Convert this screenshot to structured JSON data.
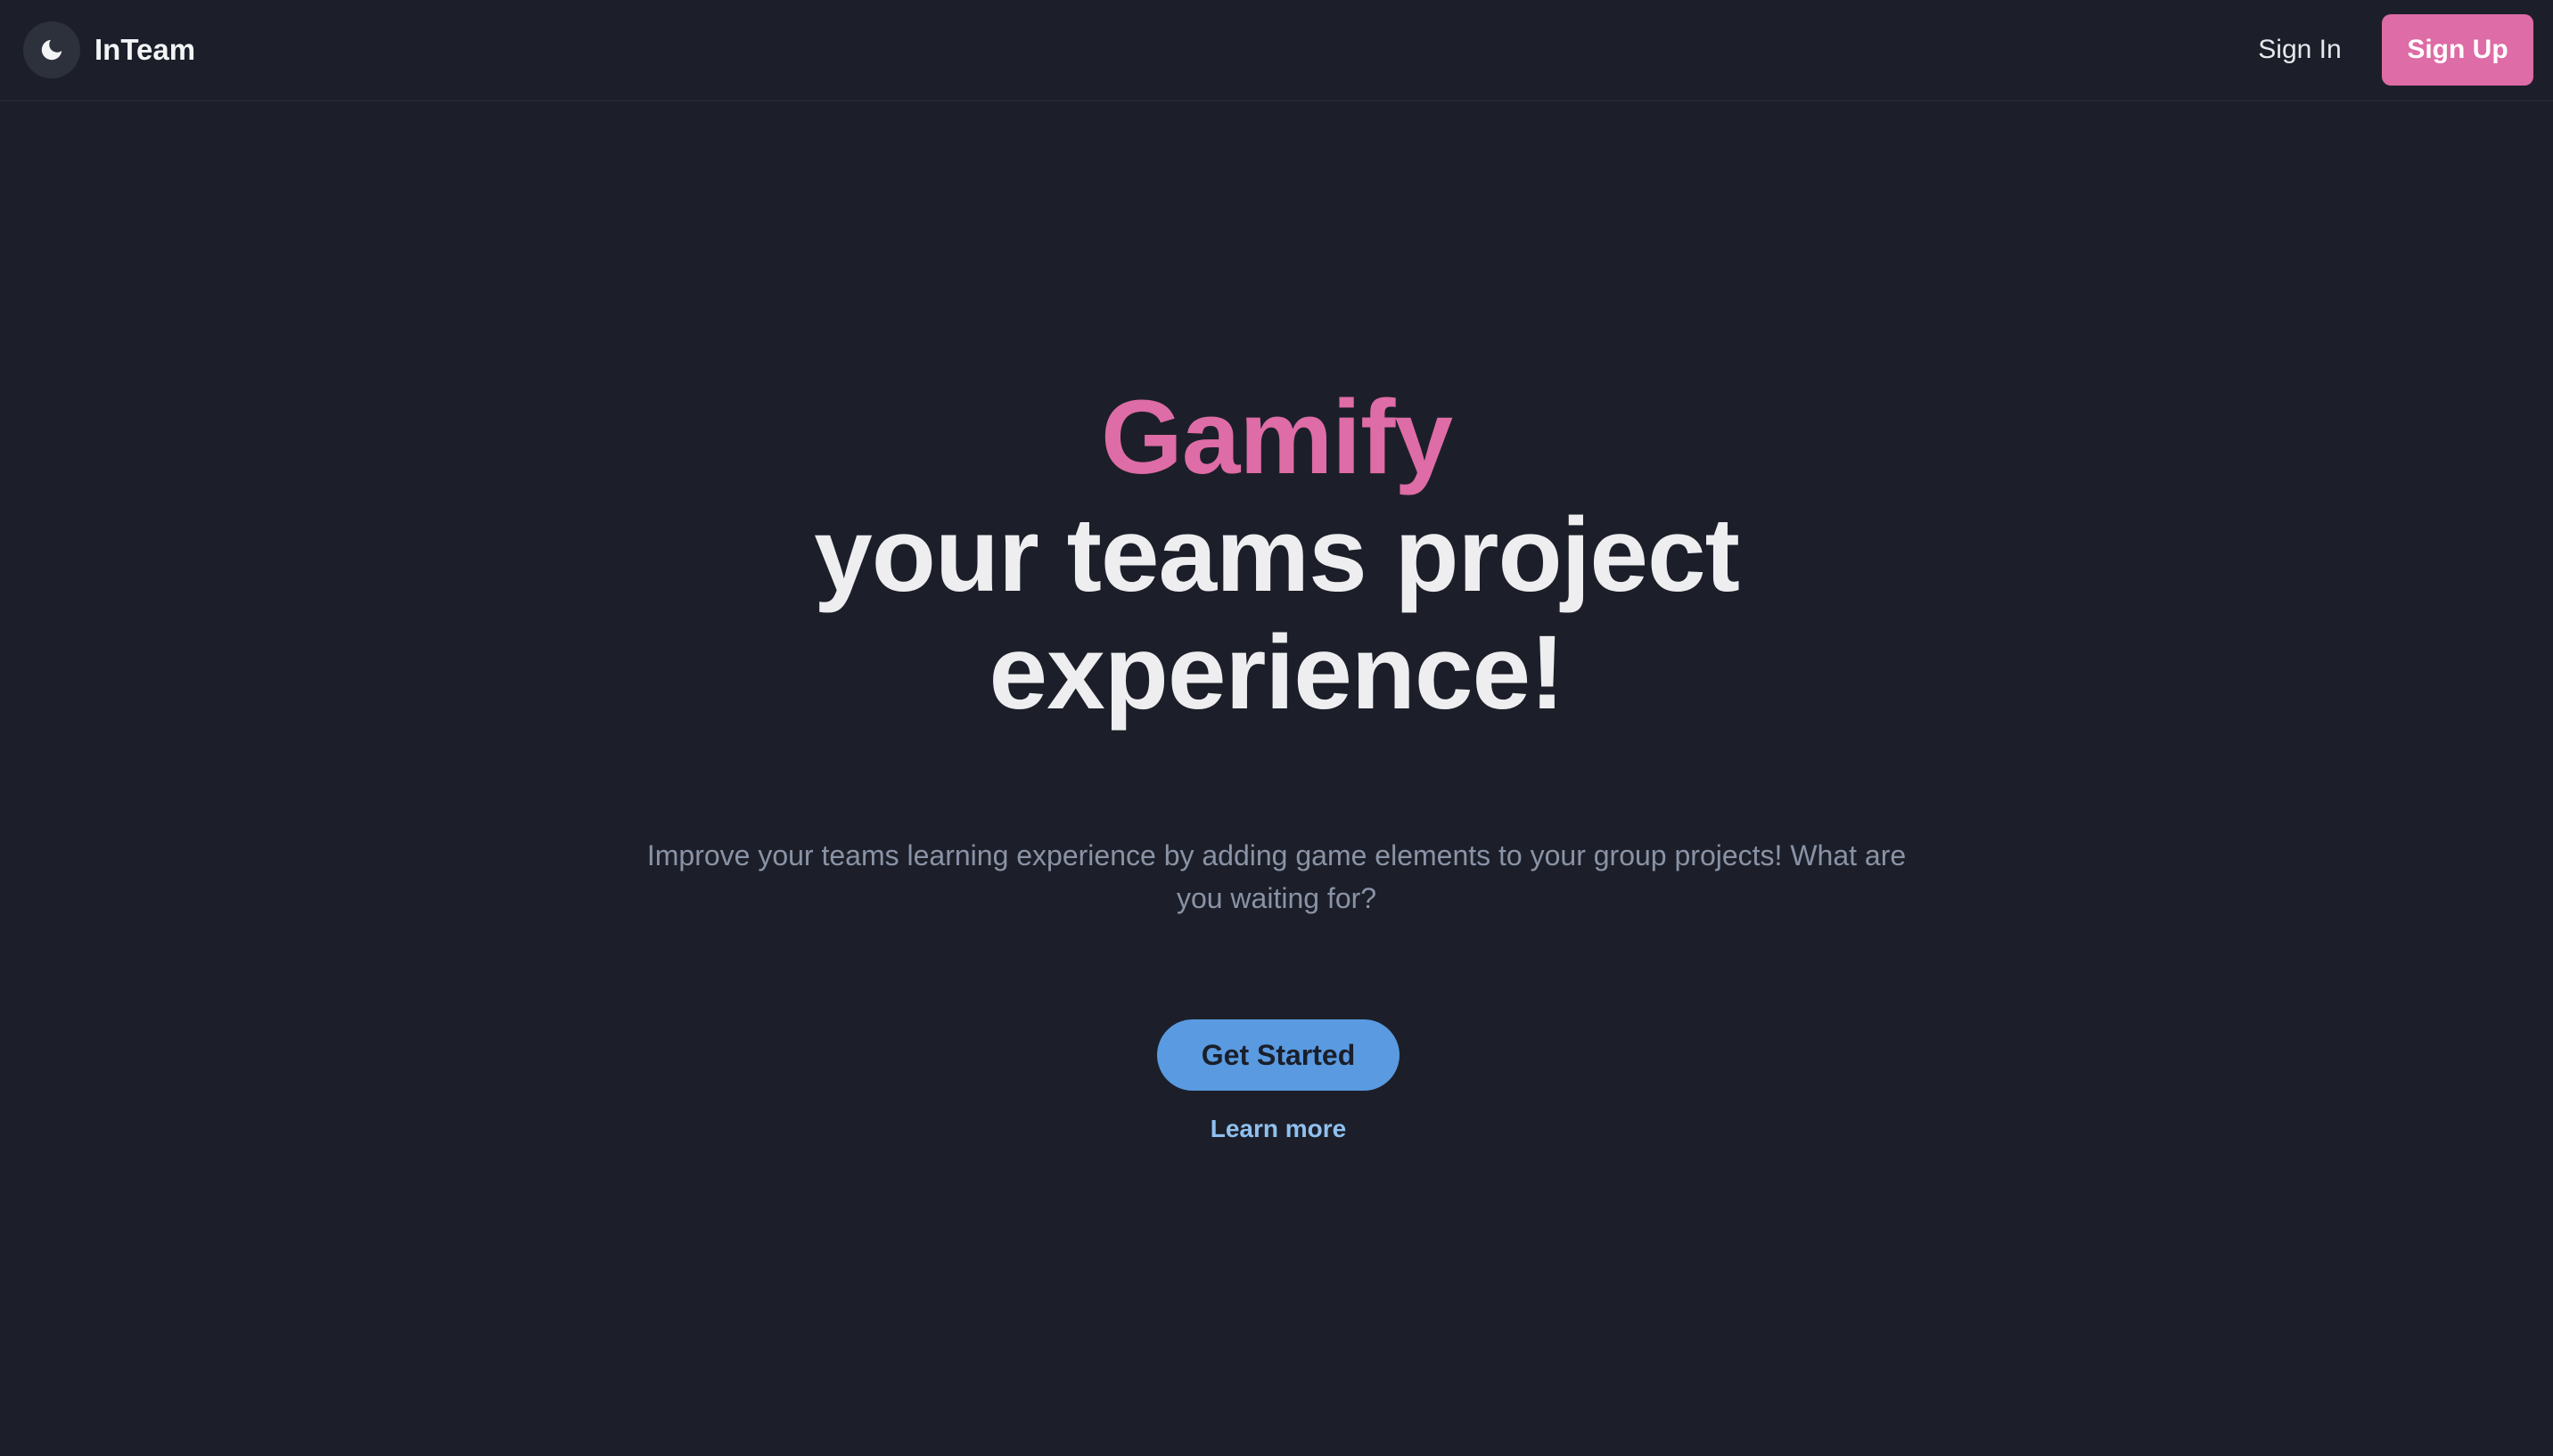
{
  "header": {
    "brand": "InTeam",
    "theme_icon": "moon-icon",
    "signin_label": "Sign In",
    "signup_label": "Sign Up"
  },
  "hero": {
    "highlight": "Gamify",
    "headline": "your teams project experience!",
    "subtitle": "Improve your teams learning experience by adding game elements to your group projects! What are you waiting for?",
    "cta_label": "Get Started",
    "learn_more_label": "Learn more"
  },
  "colors": {
    "background": "#1c1f29",
    "accent_pink": "#de6ca6",
    "accent_blue": "#5a9ae0",
    "link_blue": "#8fc0ef"
  }
}
